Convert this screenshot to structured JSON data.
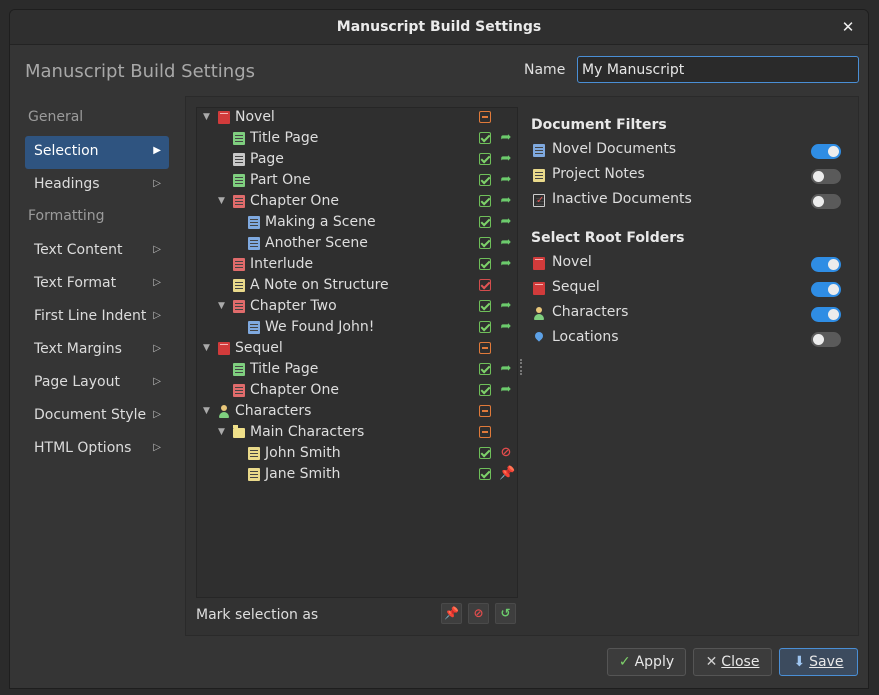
{
  "window": {
    "title": "Manuscript Build Settings",
    "close_glyph": "✕"
  },
  "header": {
    "title": "Manuscript Build Settings",
    "name_label": "Name",
    "name_value": "My Manuscript"
  },
  "nav": [
    {
      "type": "section",
      "label": "General"
    },
    {
      "type": "item",
      "label": "Selection",
      "selected": true
    },
    {
      "type": "item",
      "label": "Headings"
    },
    {
      "type": "section",
      "label": "Formatting"
    },
    {
      "type": "item",
      "label": "Text Content"
    },
    {
      "type": "item",
      "label": "Text Format"
    },
    {
      "type": "item",
      "label": "First Line Indent"
    },
    {
      "type": "item",
      "label": "Text Margins"
    },
    {
      "type": "item",
      "label": "Page Layout"
    },
    {
      "type": "item",
      "label": "Document Style"
    },
    {
      "type": "item",
      "label": "HTML Options"
    }
  ],
  "tree": [
    {
      "label": "Novel",
      "depth": 0,
      "twisty": "open",
      "icon": "book-icon",
      "state": "partial",
      "action": ""
    },
    {
      "label": "Title Page",
      "depth": 1,
      "twisty": "",
      "icon": "doc-green-icon",
      "state": "checked",
      "action": "include"
    },
    {
      "label": "Page",
      "depth": 1,
      "twisty": "",
      "icon": "doc-white-icon",
      "state": "checked",
      "action": "include"
    },
    {
      "label": "Part One",
      "depth": 1,
      "twisty": "",
      "icon": "doc-green-icon",
      "state": "checked",
      "action": "include"
    },
    {
      "label": "Chapter One",
      "depth": 1,
      "twisty": "open",
      "icon": "doc-red-icon",
      "state": "checked",
      "action": "include"
    },
    {
      "label": "Making a Scene",
      "depth": 2,
      "twisty": "",
      "icon": "doc-blue-icon",
      "state": "checked",
      "action": "include"
    },
    {
      "label": "Another Scene",
      "depth": 2,
      "twisty": "",
      "icon": "doc-blue-icon",
      "state": "checked",
      "action": "include"
    },
    {
      "label": "Interlude",
      "depth": 1,
      "twisty": "",
      "icon": "doc-red-icon",
      "state": "checked",
      "action": "include"
    },
    {
      "label": "A Note on Structure",
      "depth": 1,
      "twisty": "",
      "icon": "doc-yellow-icon",
      "state": "excluded",
      "action": ""
    },
    {
      "label": "Chapter Two",
      "depth": 1,
      "twisty": "open",
      "icon": "doc-red-icon",
      "state": "checked",
      "action": "include"
    },
    {
      "label": "We Found John!",
      "depth": 2,
      "twisty": "",
      "icon": "doc-blue-icon",
      "state": "checked",
      "action": "include"
    },
    {
      "label": "Sequel",
      "depth": 0,
      "twisty": "open",
      "icon": "book-icon",
      "state": "partial",
      "action": ""
    },
    {
      "label": "Title Page",
      "depth": 1,
      "twisty": "",
      "icon": "doc-green-icon",
      "state": "checked",
      "action": "include"
    },
    {
      "label": "Chapter One",
      "depth": 1,
      "twisty": "",
      "icon": "doc-red-icon",
      "state": "checked",
      "action": "include"
    },
    {
      "label": "Characters",
      "depth": 0,
      "twisty": "open",
      "icon": "person-icon",
      "state": "partial",
      "action": ""
    },
    {
      "label": "Main Characters",
      "depth": 1,
      "twisty": "open",
      "icon": "folder-icon",
      "state": "partial",
      "action": ""
    },
    {
      "label": "John Smith",
      "depth": 2,
      "twisty": "",
      "icon": "doc-yellow-icon",
      "state": "checked",
      "action": "exclude"
    },
    {
      "label": "Jane Smith",
      "depth": 2,
      "twisty": "",
      "icon": "doc-yellow-icon",
      "state": "checked",
      "action": "pinned"
    }
  ],
  "mark_selection": {
    "label": "Mark selection as"
  },
  "filters": {
    "heading": "Document Filters",
    "items": [
      {
        "label": "Novel Documents",
        "icon": "doc-blue-icon",
        "on": true
      },
      {
        "label": "Project Notes",
        "icon": "doc-yellow-icon",
        "on": false
      },
      {
        "label": "Inactive Documents",
        "icon": "inactive-icon",
        "on": false
      }
    ]
  },
  "roots": {
    "heading": "Select Root Folders",
    "items": [
      {
        "label": "Novel",
        "icon": "book-icon",
        "on": true
      },
      {
        "label": "Sequel",
        "icon": "book-icon",
        "on": true
      },
      {
        "label": "Characters",
        "icon": "person-icon",
        "on": true
      },
      {
        "label": "Locations",
        "icon": "location-icon",
        "on": false
      }
    ]
  },
  "buttons": {
    "apply": "Apply",
    "close": "Close",
    "save": "Save"
  },
  "colors": {
    "accent": "#2f8de4",
    "selection": "#2f5480",
    "check": "#7ed26a",
    "exclude": "#e04c4c"
  }
}
